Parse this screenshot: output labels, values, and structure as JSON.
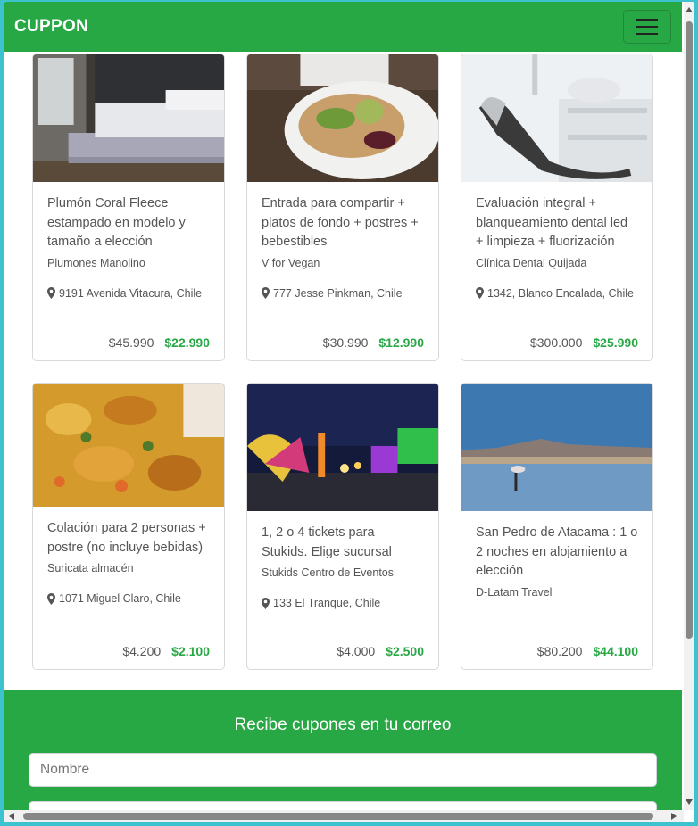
{
  "navbar": {
    "brand": "CUPPON",
    "menu_icon": "hamburger-icon"
  },
  "colors": {
    "accent": "#28a745",
    "price_new": "#28a745",
    "text": "#555555"
  },
  "deals": [
    {
      "title": "Plumón Coral Fleece estampado en modelo y tamaño a elección",
      "vendor": "Plumones Manolino",
      "location": "9191 Avenida Vitacura, Chile",
      "old_price": "$45.990",
      "new_price": "$22.990",
      "image": "bedroom-photo"
    },
    {
      "title": "Entrada para compartir + platos de fondo + postres + bebestibles",
      "vendor": "V for Vegan",
      "location": "777 Jesse Pinkman, Chile",
      "old_price": "$30.990",
      "new_price": "$12.990",
      "image": "salad-plate-photo"
    },
    {
      "title": "Evaluación integral + blanqueamiento dental led + limpieza + fluorización",
      "vendor": "Clínica Dental Quijada",
      "location": "1342, Blanco Encalada, Chile",
      "old_price": "$300.000",
      "new_price": "$25.990",
      "image": "dental-chair-photo"
    },
    {
      "title": "Colación para 2 personas + postre (no incluye bebidas)",
      "vendor": "Suricata almacén",
      "location": "1071 Miguel Claro, Chile",
      "old_price": "$4.200",
      "new_price": "$2.100",
      "image": "food-dish-photo"
    },
    {
      "title": "1, 2 o 4 tickets para Stukids. Elige sucursal",
      "vendor": "Stukids Centro de Eventos",
      "location": "133 El Tranque, Chile",
      "old_price": "$4.000",
      "new_price": "$2.500",
      "image": "fair-lights-photo"
    },
    {
      "title": "San Pedro de Atacama : 1 o 2 noches en alojamiento a elección",
      "vendor": "D-Latam Travel",
      "location": "",
      "old_price": "$80.200",
      "new_price": "$44.100",
      "image": "atacama-lagoon-photo"
    }
  ],
  "subscribe": {
    "heading": "Recibe cupones en tu correo",
    "name_placeholder": "Nombre",
    "email_placeholder": ""
  }
}
